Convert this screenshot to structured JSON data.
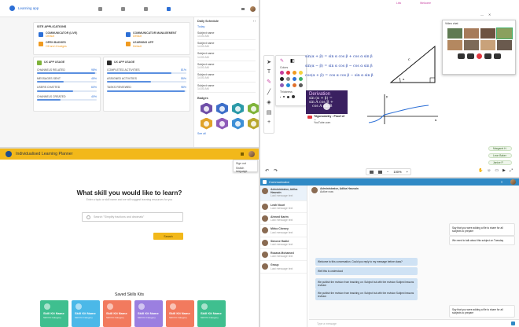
{
  "dashboard": {
    "brand": "Learning app",
    "site_apps_title": "SITE APPLICATIONS",
    "apps": [
      {
        "name": "COMMUNICATOR (LIVE)",
        "status": "Default"
      },
      {
        "name": "COMMUNICATOR MANAGEMENT",
        "status": "Default"
      },
      {
        "name": "OPEN BADGES",
        "status": "Off and 4 badges"
      },
      {
        "name": "LEARNING APP",
        "status": "Default"
      }
    ],
    "card_a_title": "UX APP USAGE",
    "card_b_title": "UX APP USAGE",
    "progress_a": [
      {
        "label": "CHANNELS RELATED",
        "value": "98%",
        "pct": 0.98
      },
      {
        "label": "MESSAGES SENT",
        "value": "45%",
        "pct": 0.45
      },
      {
        "label": "USERS CHATTED",
        "value": "60%",
        "pct": 0.6
      },
      {
        "label": "CHANNELS CREATED",
        "value": "40%",
        "pct": 0.4
      }
    ],
    "progress_b": [
      {
        "label": "COMPLETED ACTIVITIES",
        "value": "81%",
        "pct": 0.81
      },
      {
        "label": "ASSIGNED ACTIVITIES",
        "value": "55%",
        "pct": 0.55
      },
      {
        "label": "TASKS REVIEWED",
        "value": "98%",
        "pct": 0.98
      }
    ],
    "schedule_title": "Daily Schedule",
    "today_label": "Today",
    "schedule_items": [
      {
        "title": "Subject name",
        "time": "14:00 AM"
      },
      {
        "title": "Subject name",
        "time": "14:00 AM"
      },
      {
        "title": "Subject name",
        "time": "14:00 AM"
      },
      {
        "title": "Subject name",
        "time": "14:00 AM"
      },
      {
        "title": "Subject name",
        "time": "14:00 AM"
      },
      {
        "title": "Subject name",
        "time": "14:00 AM"
      }
    ],
    "badges_title": "Badges",
    "badge_colors": [
      "#6f4fa8",
      "#3d6fc9",
      "#2b9aa8",
      "#7fb33a",
      "#e0a22a",
      "#8e5bb8",
      "#3d8fd6",
      "#b8a72e"
    ],
    "see_all": "See all"
  },
  "whiteboard": {
    "equations": [
      "sin(α + β) = sin α cos β + cos α sin β",
      "sin(α − β) = sin α cos β − cos α sin β",
      "cos(α + β) = cos α cos β − sin α sin β"
    ],
    "video_title": "Derivation",
    "video_line1": "sin (α + β) =",
    "video_line2": "sin A cos B +",
    "video_line3": "cos A sin B",
    "video_caption": "Trigonometry : Proof of ...",
    "video_channel": "YouTube.com",
    "video_chat_title": "Video chat",
    "palette_title": "Colors",
    "thickness_label": "Thickness",
    "participants": [
      "Margaret H.",
      "Leon Baker",
      "Janice P."
    ],
    "zoom": "100%",
    "top_right_labels": [
      "Link",
      "Welcome"
    ],
    "palette_colors": [
      "#c63ea0",
      "#e2373f",
      "#f09a1f",
      "#f4d23a",
      "#222222",
      "#888888",
      "#2c6fd6",
      "#3fb06a",
      "#8e5bb8",
      "#1f8ad6",
      "#e06f2b",
      "#5a5a5a"
    ]
  },
  "planner": {
    "title": "Individualised Learning Planner",
    "headline": "What skill you would like to learn?",
    "subtext": "Enter a topic or skill name and we will suggest learning resources for you",
    "search_placeholder": "Search \"Simplify fractions and decimals\"",
    "search_button": "Search",
    "menu_items": [
      "Sign out",
      "Switch language"
    ],
    "saved_title": "Saved Skills Kits",
    "kits": [
      {
        "name": "Skill Kit Name",
        "sub": "Skill Kit Category",
        "color": "#3fbf8f"
      },
      {
        "name": "Skill Kit Name",
        "sub": "Skill Kit Category",
        "color": "#4bb8e8"
      },
      {
        "name": "Skill Kit Name",
        "sub": "Skill Kit Category",
        "color": "#f27a5e"
      },
      {
        "name": "Skill Kit Name",
        "sub": "Skill Kit Category",
        "color": "#9b7fe0"
      },
      {
        "name": "Skill Kit Name",
        "sub": "Skill Kit Category",
        "color": "#f27a5e"
      },
      {
        "name": "Skill Kit Name",
        "sub": "Skill Kit Category",
        "color": "#3fbf8f"
      }
    ]
  },
  "communicator": {
    "title": "Communicator",
    "contacts": [
      {
        "name": "Administrator, Adiba Hasnain",
        "preview": "Last message text"
      },
      {
        "name": "Leah Nouri",
        "preview": "Last message text"
      },
      {
        "name": "Ahmed Karim",
        "preview": "Last message text"
      },
      {
        "name": "Mirko Cheney",
        "preview": "Last message text"
      },
      {
        "name": "Simone Hadid",
        "preview": "Last message text"
      },
      {
        "name": "Rozana Mohamed",
        "preview": "Last message text"
      },
      {
        "name": "Group",
        "preview": "Last message text"
      }
    ],
    "chat_title": "Administrator, Adiba Hasnain",
    "chat_sub": "Active now",
    "messages": [
      {
        "text": "Say that you were adding a file to share for all subjects to prepare",
        "dir": "in"
      },
      {
        "text": "We need to talk about this subject on Tuesday",
        "dir": "in"
      },
      {
        "text": "Welcome to this conversation. Could you reply to my message before class?",
        "dir": "out"
      },
      {
        "text": "Well this is understood",
        "dir": "out"
      },
      {
        "text": "We publish the revision from teaching on: Subject but with the revision Subject lessons revision",
        "dir": "out"
      },
      {
        "text": "We publish the revision from teaching on: Subject but with the revision Subject lessons revision",
        "dir": "out"
      },
      {
        "text": "Say that you were adding a file to share for all subjects to prepare",
        "dir": "in"
      }
    ],
    "input_placeholder": "Type a message"
  }
}
